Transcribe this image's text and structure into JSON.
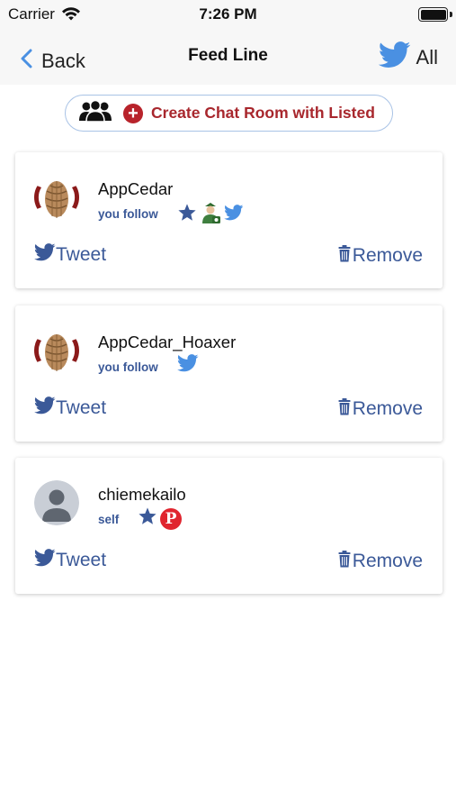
{
  "status_bar": {
    "carrier": "Carrier",
    "time": "7:26 PM"
  },
  "nav": {
    "back_label": "Back",
    "title": "Feed Line",
    "all_label": "All"
  },
  "create_room": {
    "label": "Create Chat Room with Listed"
  },
  "feed": [
    {
      "username": "AppCedar",
      "relation": "you follow",
      "badges": [
        "star-icon",
        "agent-icon",
        "twitter-icon"
      ],
      "avatar": "pinecone",
      "tweet_label": "Tweet",
      "remove_label": "Remove"
    },
    {
      "username": "AppCedar_Hoaxer",
      "relation": "you follow",
      "badges": [
        "twitter-icon"
      ],
      "avatar": "pinecone",
      "tweet_label": "Tweet",
      "remove_label": "Remove"
    },
    {
      "username": "chiemekailo",
      "relation": "self",
      "badges": [
        "star-icon",
        "pinterest-icon"
      ],
      "avatar": "default-person",
      "tweet_label": "Tweet",
      "remove_label": "Remove"
    }
  ],
  "colors": {
    "accent_blue": "#3b5998",
    "twitter_blue": "#4a90e2",
    "create_red": "#a8272d",
    "pill_border": "#a9c3e6"
  }
}
